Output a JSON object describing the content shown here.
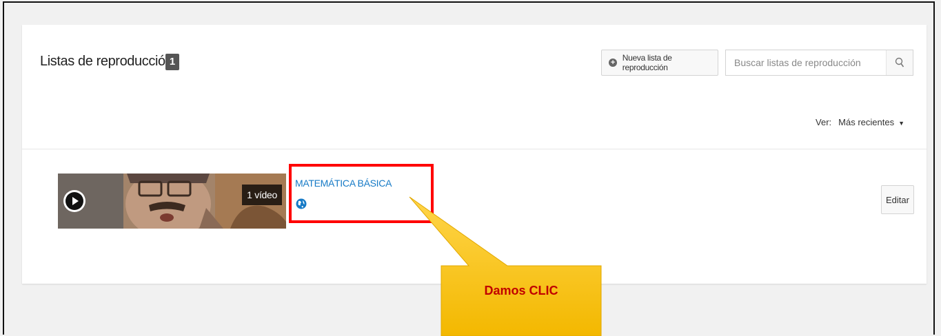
{
  "header": {
    "title": "Listas de reproducción",
    "count": "1",
    "new_playlist_label": "Nueva lista de reproducción",
    "search_placeholder": "Buscar listas de reproducción"
  },
  "sort": {
    "label": "Ver:",
    "value": "Más recientes"
  },
  "playlists": [
    {
      "title": "MATEMÁTICA BÁSICA",
      "video_count": "1 vídeo",
      "privacy_icon": "globe-icon",
      "edit_label": "Editar"
    }
  ],
  "annotation": {
    "text": "Damos CLIC",
    "highlight_color": "#ff0000",
    "callout_color": "#ffc000"
  },
  "colors": {
    "link": "#167ac6",
    "badge": "#555555"
  }
}
